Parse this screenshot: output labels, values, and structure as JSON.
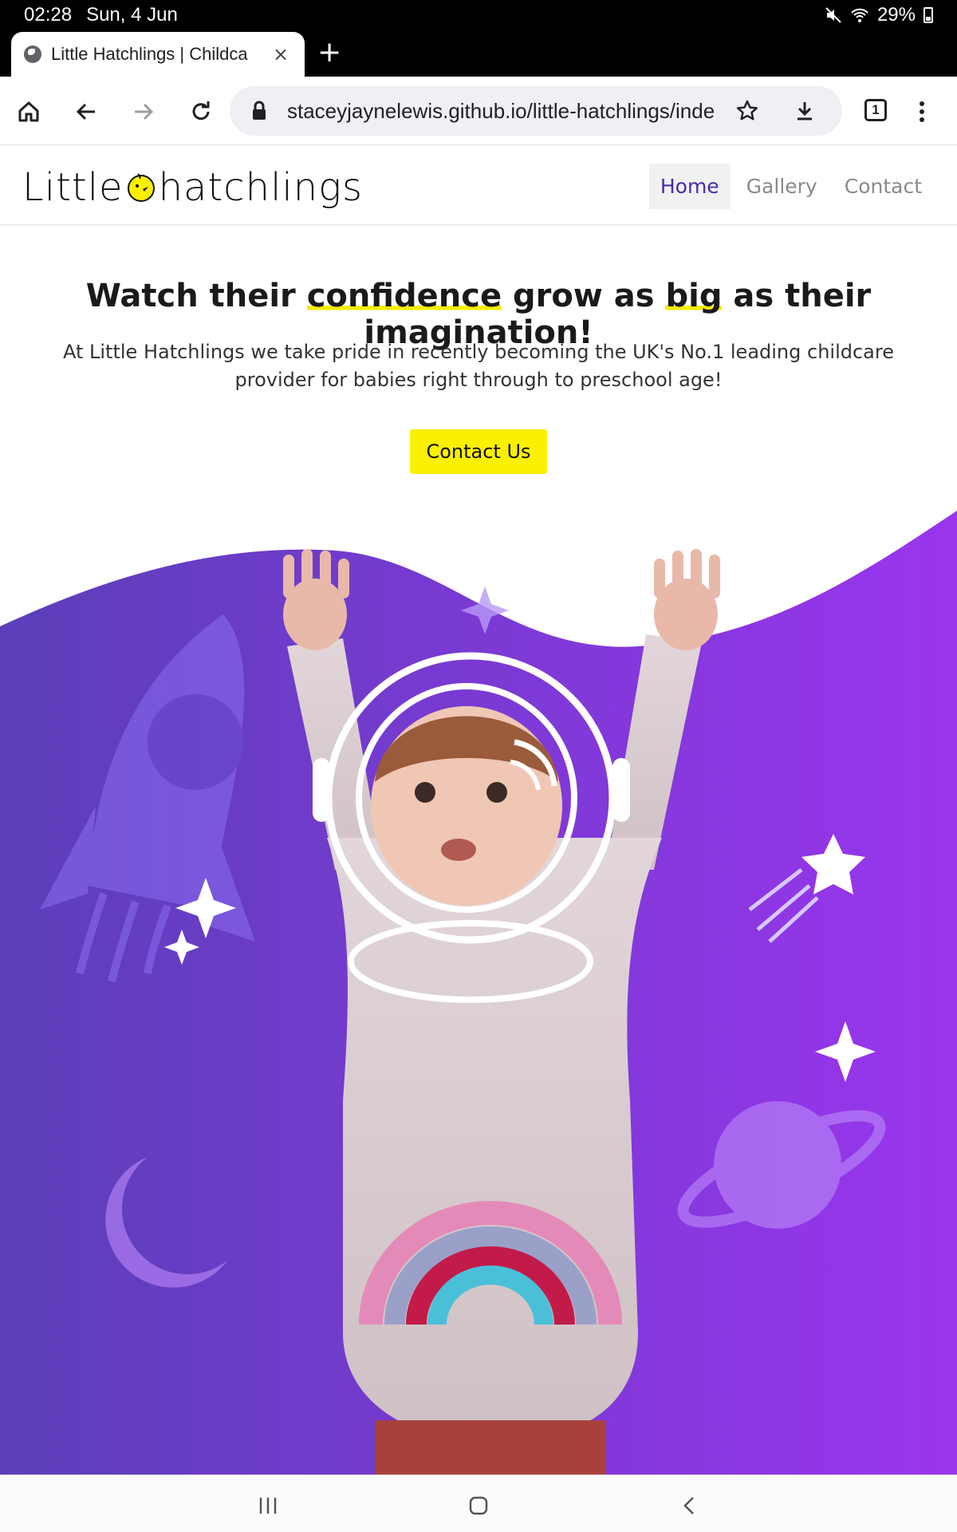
{
  "status": {
    "time": "02:28",
    "date": "Sun, 4 Jun",
    "battery": "29%"
  },
  "browser": {
    "tab_title": "Little Hatchlings | Childca",
    "tab_close": "×",
    "new_tab": "+",
    "url": "staceyjaynelewis.github.io/little-hatchlings/inde",
    "tab_count": "1"
  },
  "site": {
    "logo_left": "Little",
    "logo_right": "hatchlings",
    "nav": [
      {
        "label": "Home",
        "active": true
      },
      {
        "label": "Gallery",
        "active": false
      },
      {
        "label": "Contact",
        "active": false
      }
    ]
  },
  "hero": {
    "title_part1": "Watch their ",
    "title_hl1": "confidence",
    "title_part2": " grow as ",
    "title_hl2": "big",
    "title_part3": " as their imagination!",
    "subtitle": "At Little Hatchlings we take pride in recently becoming the UK's No.1 leading childcare provider for babies right through to preschool age!",
    "cta_label": "Contact Us"
  },
  "colors": {
    "accent_yellow": "#fbf000",
    "purple_left": "#5a3fb8",
    "purple_right": "#9a35ee",
    "nav_active": "#4b2aa6"
  },
  "icons": {
    "home": "home-icon",
    "back": "back-arrow-icon",
    "forward": "forward-arrow-icon",
    "reload": "reload-icon",
    "lock": "lock-icon",
    "star": "bookmark-star-icon",
    "download": "download-icon",
    "menu": "more-vert-icon"
  }
}
